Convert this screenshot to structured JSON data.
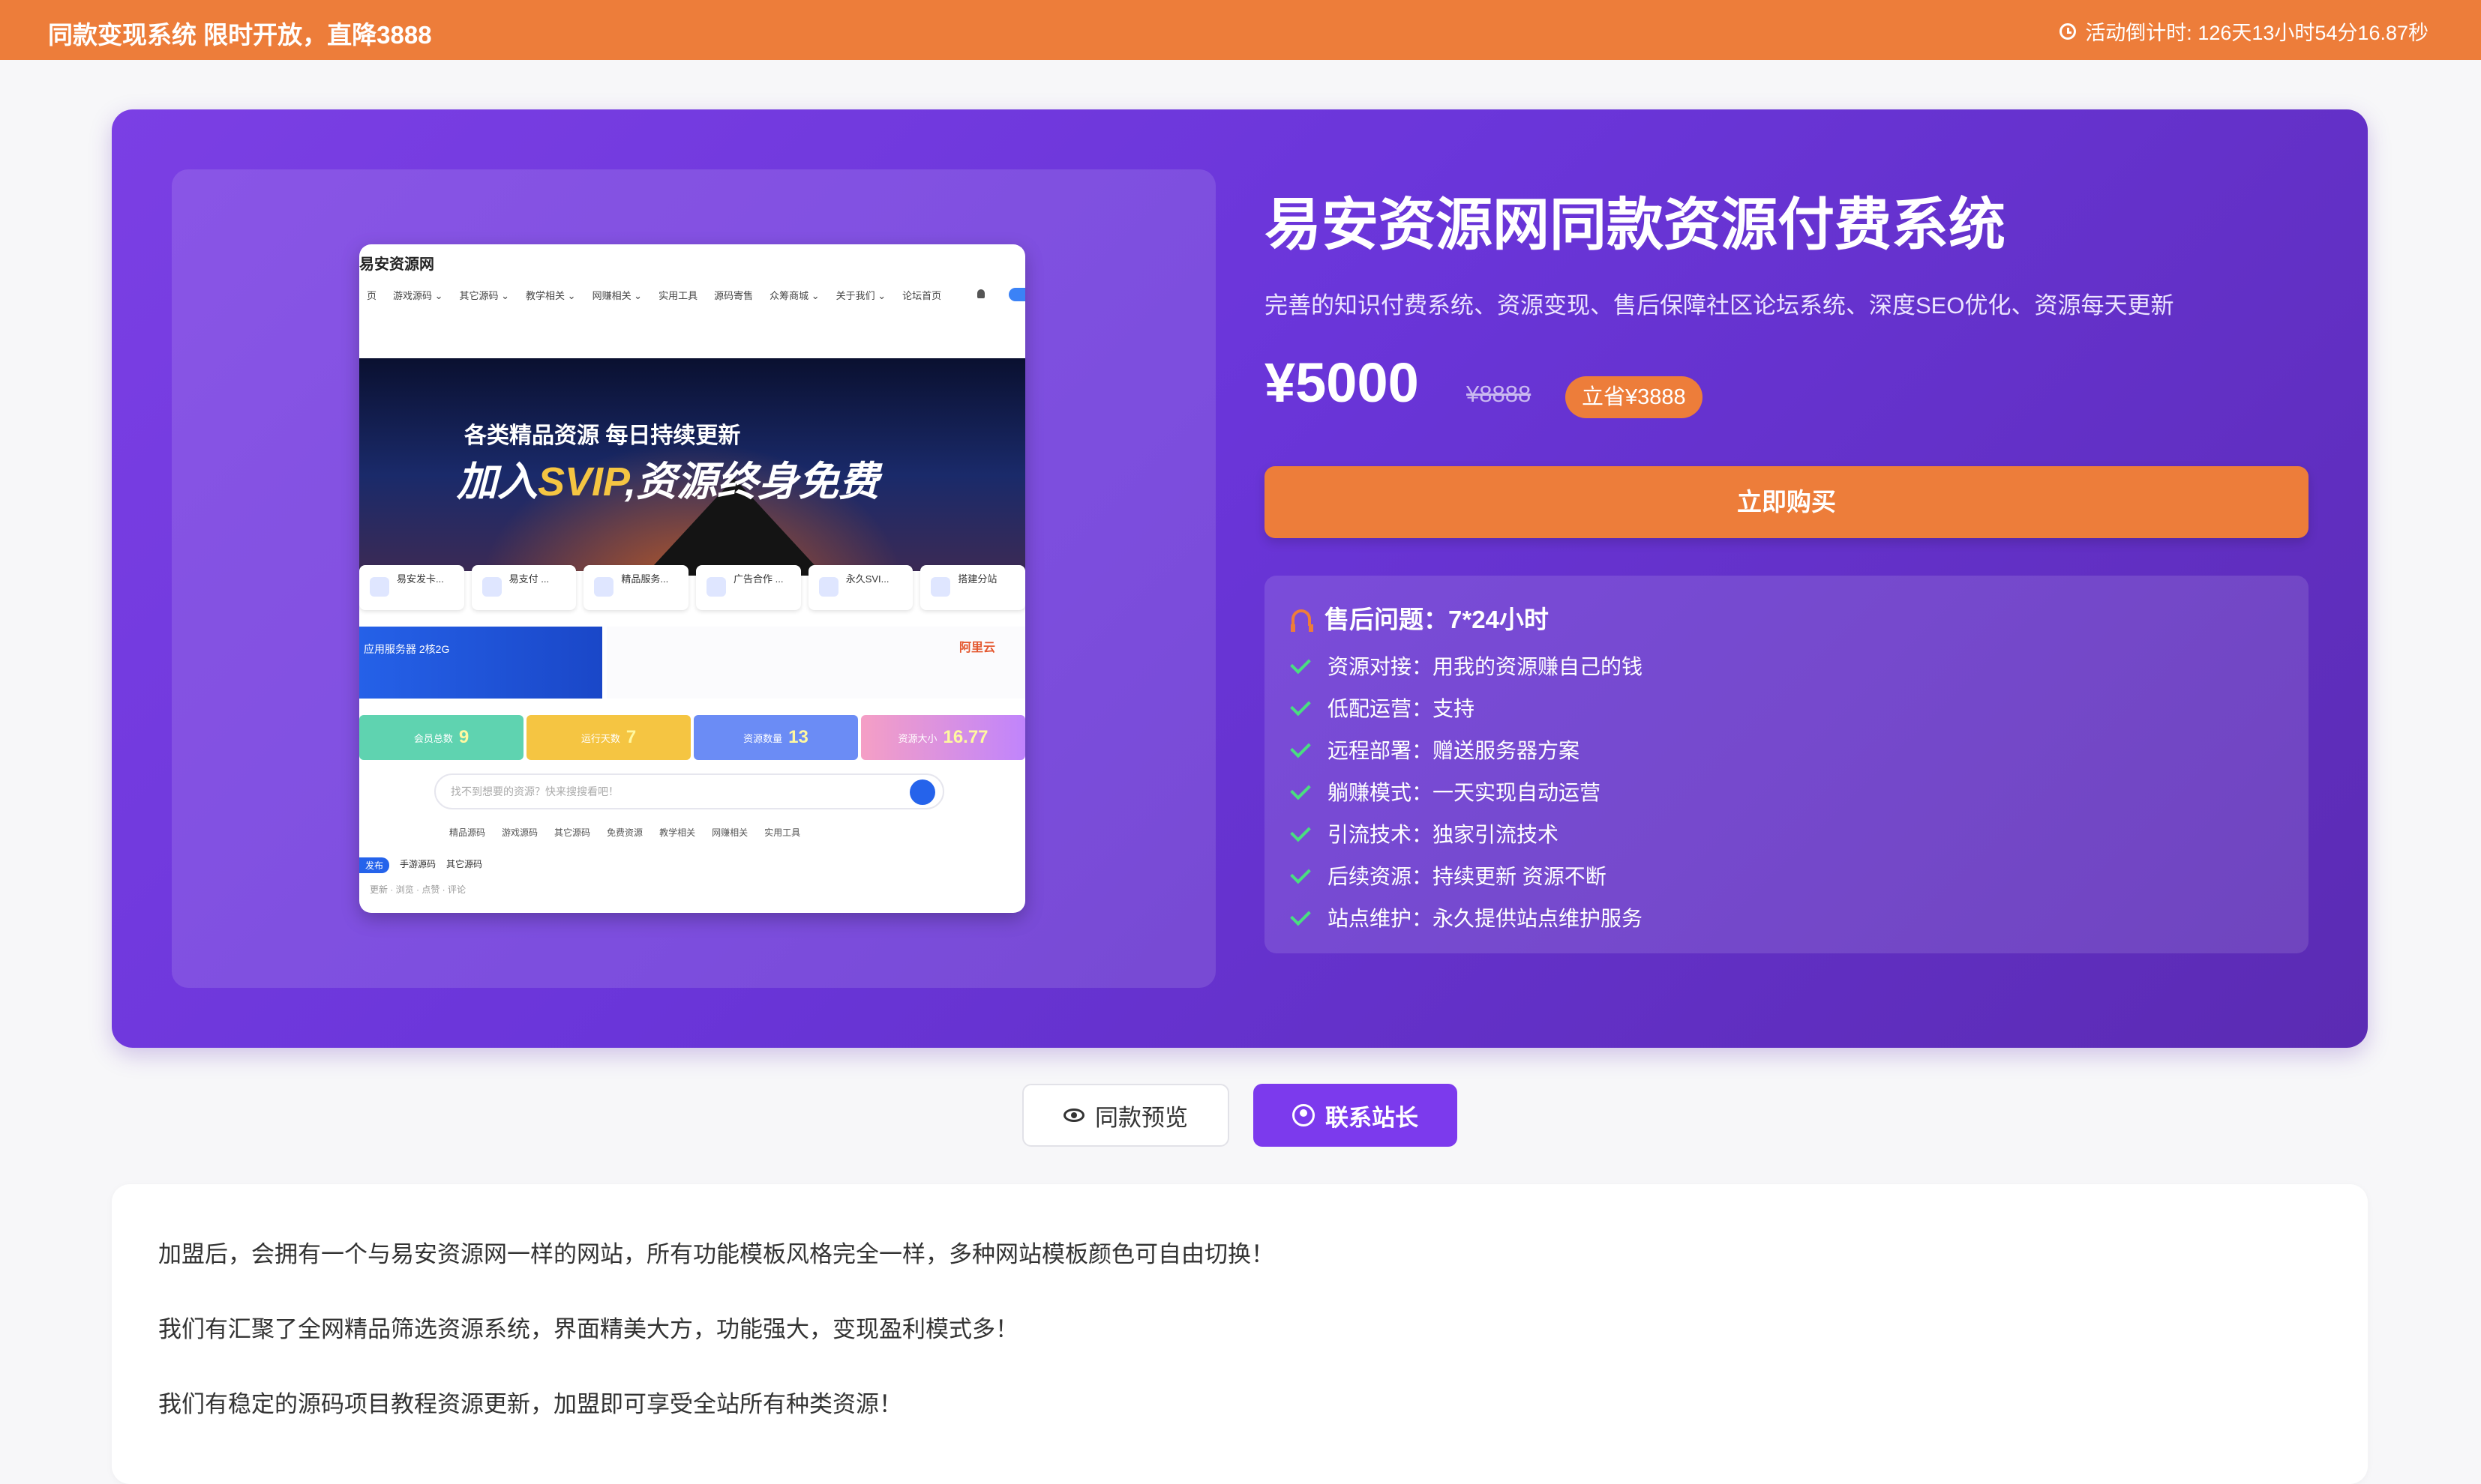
{
  "topbar": {
    "promo": "同款变现系统 限时开放，直降3888",
    "timer": "活动倒计时: 126天13小时54分16.87秒",
    "icon": "clock-icon",
    "color": "#ed7d3a"
  },
  "screenshot": {
    "logo": "易安资源网",
    "nav": [
      "页",
      "游戏源码 ⌄",
      "其它源码 ⌄",
      "教学相关 ⌄",
      "网赚相关 ⌄",
      "实用工具",
      "源码寄售",
      "众筹商城 ⌄",
      "关于我们 ⌄",
      "论坛首页"
    ],
    "banner_line1": "各类精品资源  每日持续更新",
    "banner_line2_prefix": "加入",
    "banner_svip": "SVIP",
    "banner_line2_suffix": ",资源终身免费",
    "categories": [
      "易安发卡...",
      "易支付 ...",
      "精品服务...",
      "广告合作 ...",
      "永久SVI...",
      "搭建分站"
    ],
    "server_title": "应用服务器 2核2G",
    "server_brand": "阿里云",
    "stats": [
      {
        "label": "会员总数",
        "value": "9"
      },
      {
        "label": "运行天数",
        "value": "7"
      },
      {
        "label": "资源数量",
        "value": "13"
      },
      {
        "label": "资源大小",
        "value": "16.77"
      }
    ],
    "search_placeholder": "找不到想要的资源？快来搜搜看吧！",
    "tags": [
      "精品源码",
      "游戏源码",
      "其它源码",
      "免费资源",
      "教学相关",
      "网赚相关",
      "实用工具"
    ],
    "tabs": [
      "发布",
      "手游源码",
      "其它源码"
    ],
    "footer": "更新 · 浏览 · 点赞 · 评论"
  },
  "product": {
    "title": "易安资源网同款资源付费系统",
    "subtitle": "完善的知识付费系统、资源变现、售后保障社区论坛系统、深度SEO优化、资源每天更新",
    "price": "¥5000",
    "old_price": "¥8888",
    "save_badge": "立省¥3888",
    "buy_label": "立即购买"
  },
  "features": {
    "support_title": "售后问题：7*24小时",
    "items": [
      "资源对接：用我的资源赚自己的钱",
      "低配运营：支持",
      "远程部署：赠送服务器方案",
      "躺赚模式：一天实现自动运营",
      "引流技术：独家引流技术",
      "后续资源：持续更新 资源不断",
      "站点维护：永久提供站点维护服务"
    ]
  },
  "actions": {
    "preview_label": "同款预览",
    "contact_label": "联系站长"
  },
  "description": [
    "加盟后，会拥有一个与易安资源网一样的网站，所有功能模板风格完全一样，多种网站模板颜色可自由切换！",
    "我们有汇聚了全网精品筛选资源系统，界面精美大方，功能强大，变现盈利模式多！",
    "我们有稳定的源码项目教程资源更新，加盟即可享受全站所有种类资源！"
  ],
  "colors": {
    "accent_orange": "#ed7d3a",
    "hero_purple": "#6a35d9",
    "contact_purple": "#7c3aed",
    "check_green": "#4ade80"
  }
}
